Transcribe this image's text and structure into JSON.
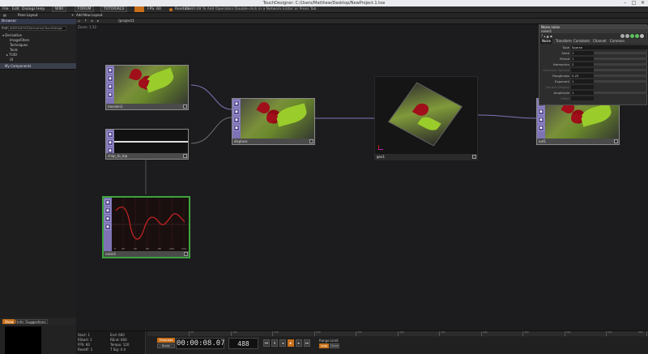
{
  "window": {
    "title": "TouchDesigner: C:/Users/Matthew/Desktop/NewProject.1.toe"
  },
  "menu": {
    "items": [
      "File",
      "Edit",
      "Dialogs",
      "Help"
    ],
    "buttons": [
      "WIKI",
      "FORUM",
      "TUTORIALS"
    ],
    "fps_label": "FPS: 60",
    "realtime_label": "Realtime",
    "message": "22:40:08 To Add Operators Double-click in a Network Editor or Press Tab"
  },
  "toolbar": {
    "pane_layout": "Pane Layout",
    "new_project": "Add New Layout"
  },
  "browser": {
    "header": "Browser",
    "path_label": "Path:",
    "path_value": "$DERIVATIVE\\Derivative\\TouchDesign",
    "tree": [
      "Derivative",
      "ImageFilters",
      "Techniques",
      "Tools",
      "TUIO",
      "UI"
    ],
    "selected": "My Components",
    "tabs": [
      "Show",
      "Info",
      "Suggestions"
    ]
  },
  "network": {
    "path": "/project1",
    "zoom": "Zoom: 1.52",
    "nodes": {
      "movie": "moviein1",
      "chop": "chop_to_top",
      "displace": "displace",
      "geo": "geo1",
      "out": "out1",
      "noise": "noise1"
    },
    "graph": {
      "x_ticks": [
        "5",
        "20",
        "40",
        "60",
        "80",
        "100",
        "120"
      ]
    }
  },
  "params": {
    "header": "Noise   noise",
    "subheader": "noise1",
    "tabs": [
      "Noise",
      "Transform",
      "Constants",
      "Channel",
      "Common"
    ],
    "rows": [
      {
        "label": "Type",
        "value": "Sparse"
      },
      {
        "label": "Seed",
        "value": "1"
      },
      {
        "label": "Period",
        "value": "1"
      },
      {
        "label": "Harmonics",
        "value": "2"
      },
      {
        "label": "Harmonic Spread",
        "value": ""
      },
      {
        "label": "Roughness",
        "value": "0.25"
      },
      {
        "label": "Exponent",
        "value": "1"
      },
      {
        "label": "Normal Display",
        "value": ""
      },
      {
        "label": "Amplitude",
        "value": "1"
      },
      {
        "label": "Offset",
        "value": ""
      }
    ]
  },
  "timeline": {
    "start": "Start: 1",
    "end": "End: 600",
    "rstart": "RStart: 1",
    "rend": "REnd: 600",
    "fps": "FPS: 60",
    "tempo": "Tempo: 120",
    "resetf": "ResetF: 1",
    "tsig": "T Sig: 4 4",
    "timecode": "00:00:08.07",
    "frame": "488",
    "range_label": "Range Limit",
    "loop": "Loop",
    "once": "Once",
    "beats_label": "Beats",
    "timecode_toggle": "Timecode",
    "ruler": [
      "50",
      "100",
      "150",
      "200",
      "250",
      "300",
      "350",
      "400",
      "450",
      "500",
      "550",
      "600"
    ]
  },
  "colors": {
    "accent": "#c8701b",
    "node_side": "#7e73b5",
    "selection": "#3da33d"
  }
}
